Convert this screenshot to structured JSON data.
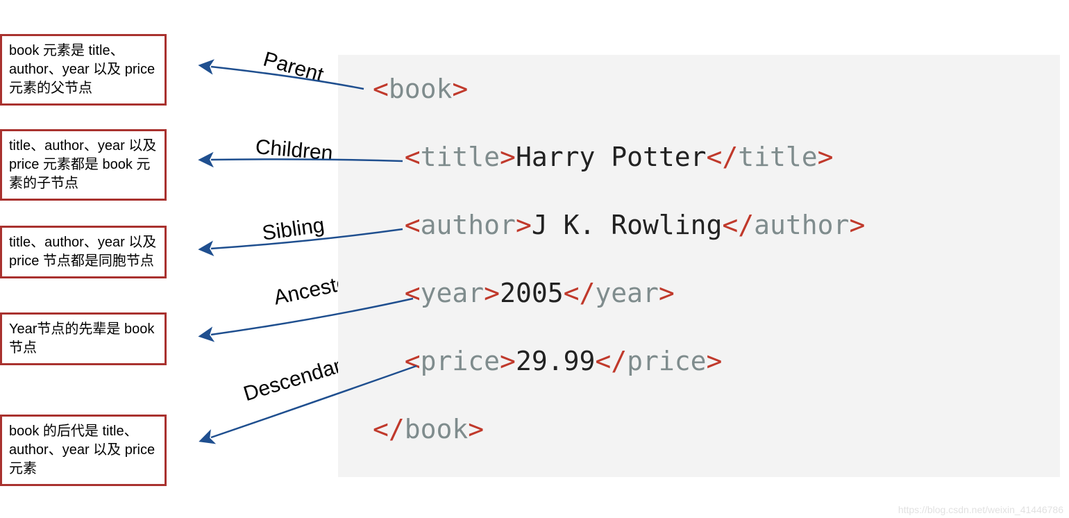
{
  "boxes": {
    "parent": "book 元素是 title、author、year 以及 price 元素的父节点",
    "children": "title、author、year 以及 price 元素都是 book 元素的子节点",
    "sibling": "title、author、year 以及 price 节点都是同胞节点",
    "ancestor": "Year节点的先辈是 book 节点",
    "descendant": "book 的后代是 title、author、year 以及 price 元素"
  },
  "labels": {
    "parent": "Parent",
    "children": "Children",
    "sibling": "Sibling",
    "ancestor": "Ancestor",
    "descendant": "Descendant"
  },
  "xml": {
    "root": "book",
    "title_tag": "title",
    "title_text": "Harry Potter",
    "author_tag": "author",
    "author_text": "J K. Rowling",
    "year_tag": "year",
    "year_text": "2005",
    "price_tag": "price",
    "price_text": "29.99"
  },
  "watermark": "https://blog.csdn.net/weixin_41446786"
}
